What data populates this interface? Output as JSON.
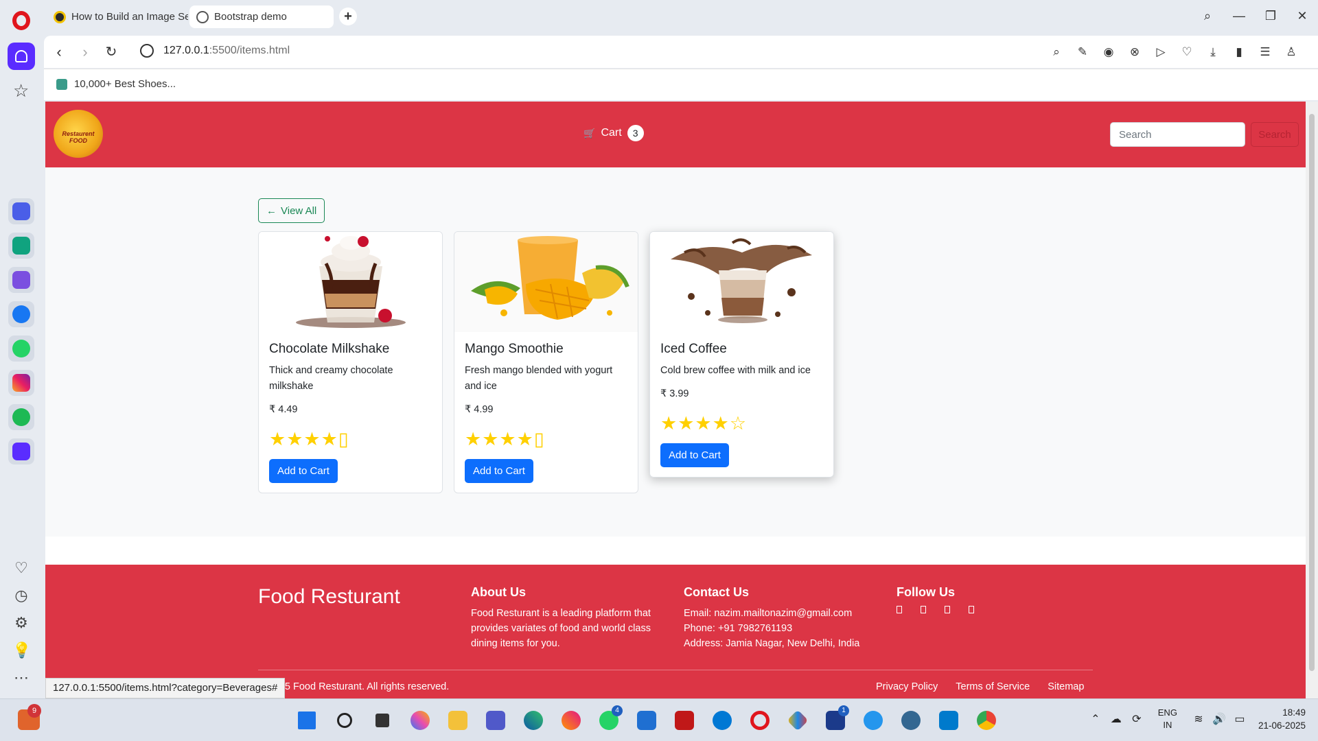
{
  "browser": {
    "tabs": [
      {
        "label": "How to Build an Image Se",
        "active": false
      },
      {
        "label": "Bootstrap demo",
        "active": true
      }
    ],
    "url_host": "127.0.0.1",
    "url_rest": ":5500/items.html",
    "bookmark": "10,000+ Best Shoes...",
    "status_url": "127.0.0.1:5500/items.html?category=Beverages#"
  },
  "header": {
    "logo_text": "Restaurent FOOD",
    "cart_label": "Cart",
    "cart_count": "3",
    "search_placeholder": "Search",
    "search_button": "Search"
  },
  "main": {
    "view_all_arrow": "←",
    "view_all_label": "View All",
    "products": [
      {
        "name": "Chocolate Milkshake",
        "description": "Thick and creamy chocolate milkshake",
        "price": "₹ 4.49",
        "stars": "★★★★▯",
        "rating": 4.5,
        "button": "Add to Cart"
      },
      {
        "name": "Mango Smoothie",
        "description": "Fresh mango blended with yogurt and ice",
        "price": "₹ 4.99",
        "stars": "★★★★▯",
        "rating": 4.5,
        "button": "Add to Cart"
      },
      {
        "name": "Iced Coffee",
        "description": "Cold brew coffee with milk and ice",
        "price": "₹ 3.99",
        "stars": "★★★★☆",
        "rating": 4,
        "button": "Add to Cart"
      }
    ]
  },
  "footer": {
    "brand": "Food Resturant",
    "about_title": "About Us",
    "about_text": "Food Resturant is a leading platform that provides variates of food and world class dining items for you.",
    "contact_title": "Contact Us",
    "email": "Email: nazim.mailtonazim@gmail.com",
    "phone": "Phone: +91 7982761193",
    "address": "Address: Jamia Nagar, New Delhi, India",
    "follow_title": "Follow Us",
    "copyright": "© 2025 Food Resturant. All rights reserved.",
    "links": [
      "Privacy Policy",
      "Terms of Service",
      "Sitemap"
    ]
  },
  "taskbar": {
    "weather_badge": "9",
    "whatsapp_badge": "4",
    "app_badge": "1",
    "lang_line1": "ENG",
    "lang_line2": "IN",
    "time": "18:49",
    "date": "21-06-2025"
  },
  "colors": {
    "brand_red": "#dc3545",
    "primary_blue": "#0d6efd",
    "success_green": "#198754",
    "star_yellow": "#ffd000",
    "opera_purple": "#5a2cff"
  }
}
